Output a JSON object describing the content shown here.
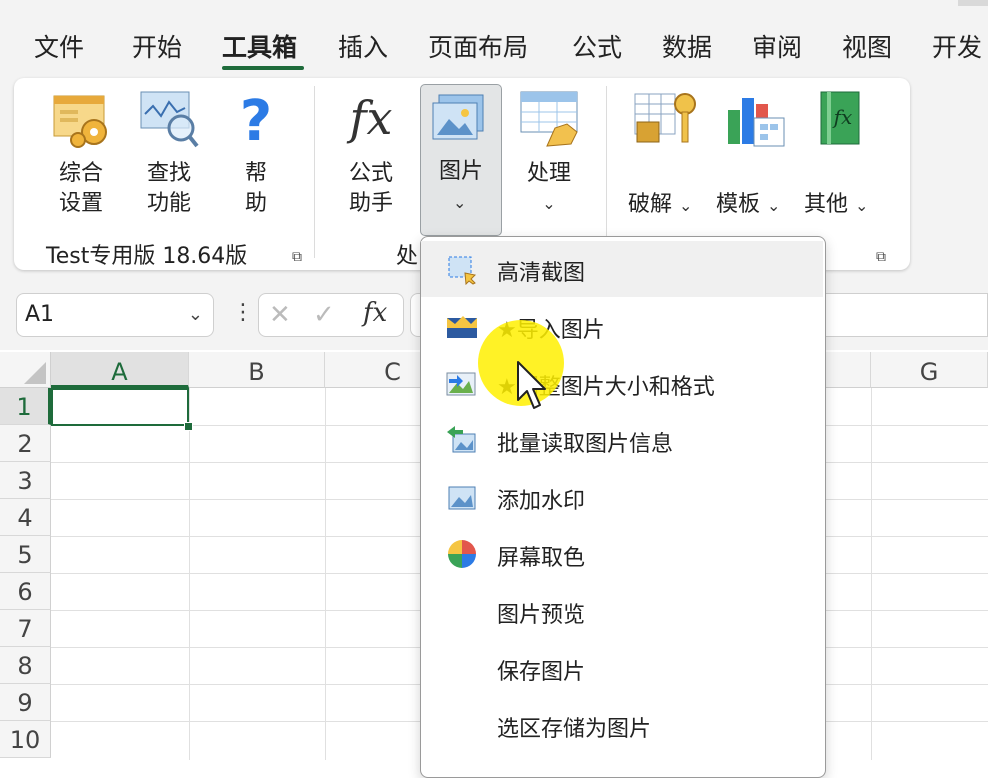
{
  "tabs": {
    "items": [
      "文件",
      "开始",
      "工具箱",
      "插入",
      "页面布局",
      "公式",
      "数据",
      "审阅",
      "视图",
      "开发"
    ],
    "active_index": 2
  },
  "ribbon": {
    "group1": {
      "buttons": [
        {
          "line1": "综合",
          "line2": "设置"
        },
        {
          "line1": "查找",
          "line2": "功能"
        },
        {
          "line1": "帮",
          "line2": "助"
        }
      ],
      "label": "Test专用版 18.64版"
    },
    "group2": {
      "formula_helper": {
        "line1": "公式",
        "line2": "助手"
      },
      "picture": {
        "label": "图片"
      },
      "process": {
        "label": "处理"
      },
      "label_partial": "处"
    },
    "group3": {
      "crack": "破解",
      "template": "模板",
      "other": "其他"
    }
  },
  "formula_bar": {
    "name_box": "A1",
    "fx": "fx"
  },
  "grid": {
    "columns": [
      "A",
      "B",
      "C",
      "G"
    ],
    "rows": [
      "1",
      "2",
      "3",
      "4",
      "5",
      "6",
      "7",
      "8",
      "9",
      "10"
    ],
    "active_cell": "A1"
  },
  "dropdown": {
    "items": [
      {
        "label": "高清截图",
        "icon": "screenshot-icon"
      },
      {
        "label": "★导入图片",
        "icon": "import-picture-icon"
      },
      {
        "label": "★调整图片大小和格式",
        "icon": "resize-picture-icon"
      },
      {
        "label": "批量读取图片信息",
        "icon": "batch-read-icon"
      },
      {
        "label": "添加水印",
        "icon": "watermark-icon"
      },
      {
        "label": "屏幕取色",
        "icon": "color-picker-icon"
      },
      {
        "label": "图片预览",
        "icon": ""
      },
      {
        "label": "保存图片",
        "icon": ""
      },
      {
        "label": "选区存储为图片",
        "icon": ""
      }
    ]
  },
  "colors": {
    "accent": "#1e6b3b",
    "cursor_highlight": "#fff000"
  }
}
